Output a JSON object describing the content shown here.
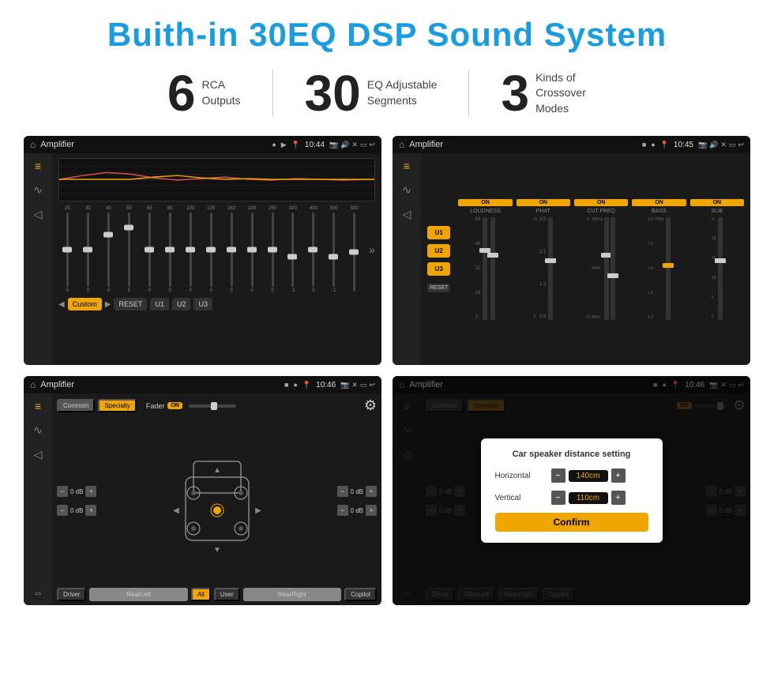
{
  "page": {
    "title": "Buith-in 30EQ DSP Sound System",
    "stats": [
      {
        "number": "6",
        "desc_line1": "RCA",
        "desc_line2": "Outputs"
      },
      {
        "number": "30",
        "desc_line1": "EQ Adjustable",
        "desc_line2": "Segments"
      },
      {
        "number": "3",
        "desc_line1": "Kinds of",
        "desc_line2": "Crossover Modes"
      }
    ]
  },
  "screen1": {
    "title": "Amplifier",
    "time": "10:44",
    "eq_freqs": [
      "25",
      "32",
      "40",
      "50",
      "63",
      "80",
      "100",
      "125",
      "160",
      "200",
      "250",
      "320",
      "400",
      "500",
      "630"
    ],
    "eq_values": [
      "0",
      "0",
      "0",
      "5",
      "0",
      "0",
      "0",
      "0",
      "0",
      "0",
      "0",
      "-1",
      "0",
      "-1",
      ""
    ],
    "buttons": [
      "Custom",
      "RESET",
      "U1",
      "U2",
      "U3"
    ]
  },
  "screen2": {
    "title": "Amplifier",
    "time": "10:45",
    "presets": [
      "U1",
      "U2",
      "U3"
    ],
    "channels": [
      {
        "header": "ON",
        "label": "LOUDNESS"
      },
      {
        "header": "ON",
        "label": "PHAT"
      },
      {
        "header": "ON",
        "label": "CUT FREQ"
      },
      {
        "header": "ON",
        "label": "BASS"
      },
      {
        "header": "ON",
        "label": "SUB"
      }
    ],
    "reset_label": "RESET"
  },
  "screen3": {
    "title": "Amplifier",
    "time": "10:46",
    "tabs": [
      "Common",
      "Specialty"
    ],
    "fader_label": "Fader",
    "fader_on": "ON",
    "db_values": [
      "0 dB",
      "0 dB",
      "0 dB",
      "0 dB"
    ],
    "bottom_buttons": [
      "Driver",
      "RearLeft",
      "All",
      "User",
      "RearRight",
      "Copilot"
    ]
  },
  "screen4": {
    "title": "Amplifier",
    "time": "10:46",
    "tabs": [
      "Common",
      "Specialty"
    ],
    "dialog": {
      "title": "Car speaker distance setting",
      "rows": [
        {
          "label": "Horizontal",
          "value": "140cm"
        },
        {
          "label": "Vertical",
          "value": "110cm"
        }
      ],
      "confirm_label": "Confirm"
    },
    "right_labels": [
      "0 dB",
      "0 dB"
    ],
    "bottom_buttons": [
      "Driver",
      "RearLeft",
      "RearRight",
      "Copilot"
    ]
  }
}
